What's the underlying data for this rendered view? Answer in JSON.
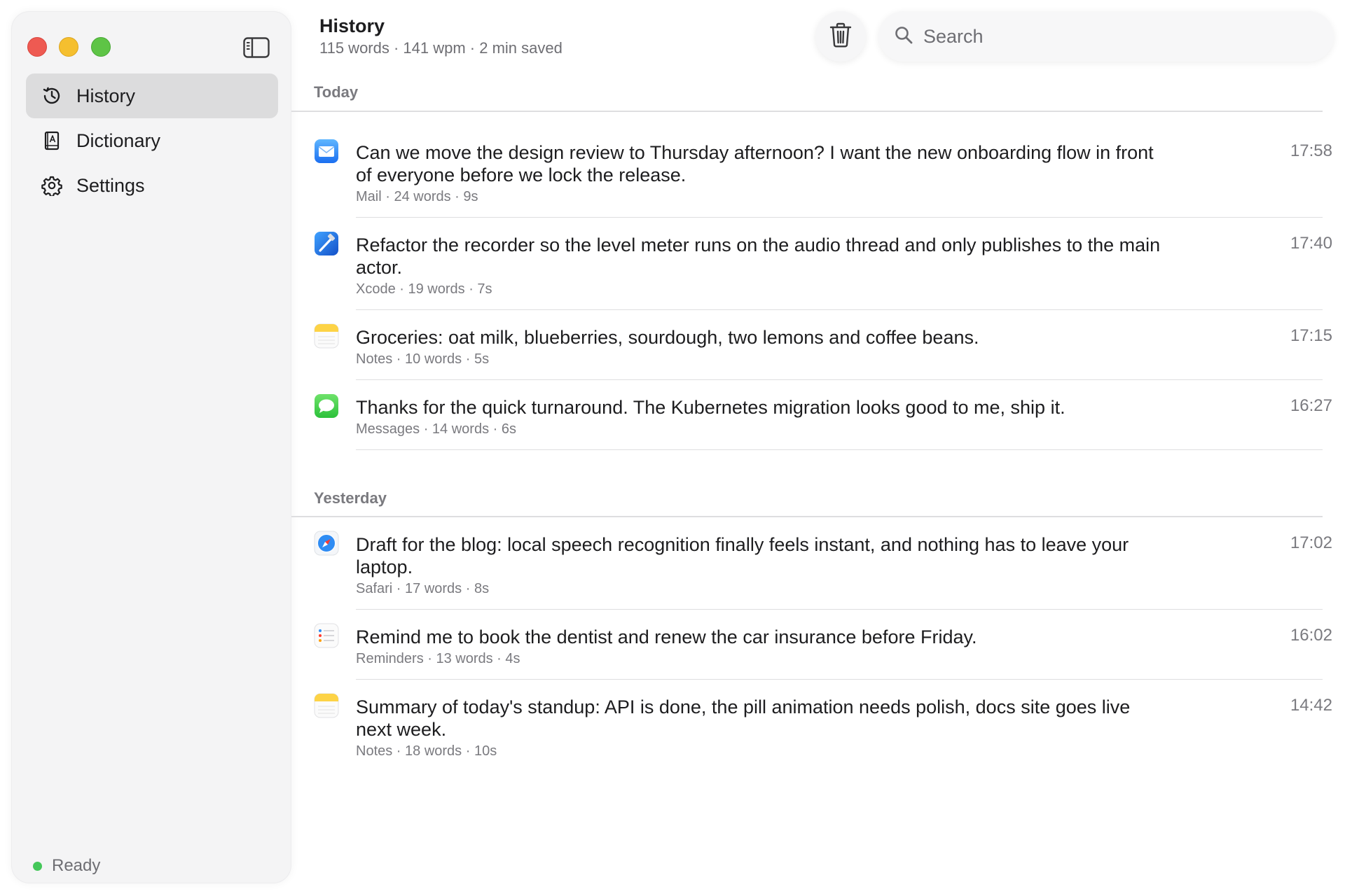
{
  "window": {
    "title": "History"
  },
  "sidebar": {
    "items": [
      {
        "label": "History",
        "icon": "history-icon",
        "active": true
      },
      {
        "label": "Dictionary",
        "icon": "book-icon",
        "active": false
      },
      {
        "label": "Settings",
        "icon": "gear-icon",
        "active": false
      }
    ],
    "status": {
      "label": "Ready",
      "color": "#44c759"
    }
  },
  "header": {
    "title": "History",
    "subtitle": "115 words · 141 wpm · 2 min saved"
  },
  "search": {
    "placeholder": "Search",
    "value": ""
  },
  "sections": [
    {
      "label": "Today",
      "entries": [
        {
          "app": "Mail",
          "text": "Can we move the design review to Thursday afternoon? I want the new onboarding flow in front of everyone before we lock the release.",
          "meta": "Mail · 24 words · 9s",
          "time": "17:58"
        },
        {
          "app": "Xcode",
          "text": "Refactor the recorder so the level meter runs on the audio thread and only publishes to the main actor.",
          "meta": "Xcode · 19 words · 7s",
          "time": "17:40"
        },
        {
          "app": "Notes",
          "text": "Groceries: oat milk, blueberries, sourdough, two lemons and coffee beans.",
          "meta": "Notes · 10 words · 5s",
          "time": "17:15"
        },
        {
          "app": "Messages",
          "text": "Thanks for the quick turnaround. The Kubernetes migration looks good to me, ship it.",
          "meta": "Messages · 14 words · 6s",
          "time": "16:27"
        }
      ]
    },
    {
      "label": "Yesterday",
      "entries": [
        {
          "app": "Safari",
          "text": "Draft for the blog: local speech recognition finally feels instant, and nothing has to leave your laptop.",
          "meta": "Safari · 17 words · 8s",
          "time": "17:02"
        },
        {
          "app": "Reminders",
          "text": "Remind me to book the dentist and renew the car insurance before Friday.",
          "meta": "Reminders · 13 words · 4s",
          "time": "16:02"
        },
        {
          "app": "Notes",
          "text": "Summary of today's standup: API is done, the pill animation needs polish, docs site goes live next week.",
          "meta": "Notes · 18 words · 10s",
          "time": "14:42"
        }
      ]
    }
  ]
}
